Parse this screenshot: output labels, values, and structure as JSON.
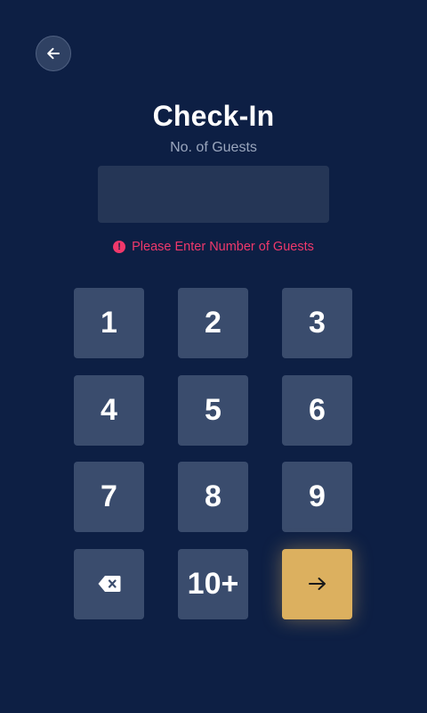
{
  "header": {
    "back_icon": "arrow-left-icon",
    "title": "Check-In",
    "subtitle": "No. of Guests"
  },
  "guest_input": {
    "value": "",
    "placeholder": ""
  },
  "error": {
    "icon": "alert-circle-icon",
    "icon_glyph": "!",
    "message": "Please Enter Number of Guests",
    "color": "#f0386b"
  },
  "keypad": {
    "keys": [
      "1",
      "2",
      "3",
      "4",
      "5",
      "6",
      "7",
      "8",
      "9"
    ],
    "backspace_icon": "backspace-icon",
    "more_label": "10+",
    "submit_icon": "arrow-right-icon",
    "submit_color": "#dcb05f"
  },
  "theme": {
    "background": "#0d1f44",
    "key_background": "#3a4c6d",
    "input_background": "#253656"
  }
}
